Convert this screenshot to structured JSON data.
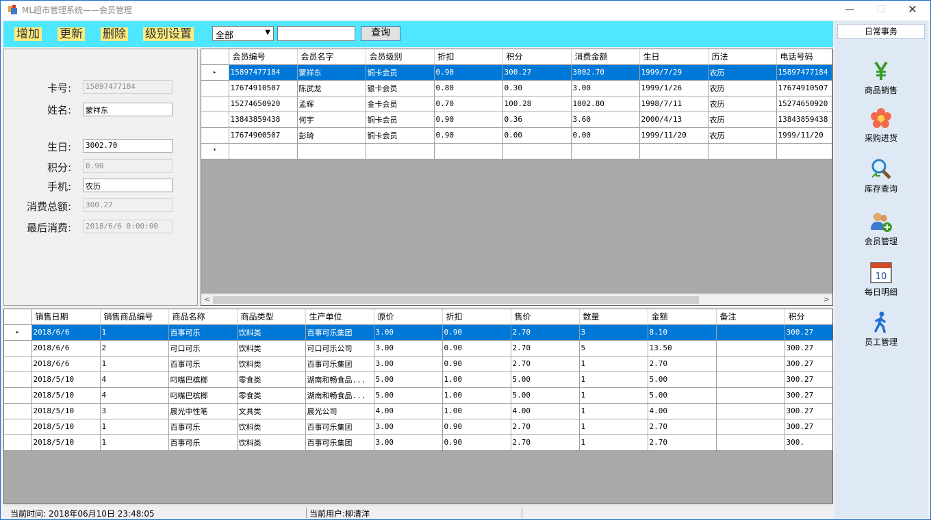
{
  "window": {
    "title": "ML超市管理系统——会员管理"
  },
  "toolbar": {
    "add_label": "增加",
    "update_label": "更新",
    "delete_label": "删除",
    "level_label": "级别设置",
    "filter_value": "全部",
    "search_value": "",
    "query_label": "查询"
  },
  "form": {
    "card_label": "卡号:",
    "card_value": "15897477184",
    "name_label": "姓名:",
    "name_value": "蒙祥东",
    "birthday_label": "生日:",
    "birthday_value": "3002.70",
    "points_label": "积分:",
    "points_value": "0.90",
    "phone_label": "手机:",
    "phone_value": "农历",
    "total_label": "消费总额:",
    "total_value": "300.27",
    "last_label": "最后消费:",
    "last_value": "2018/6/6 0:00:00"
  },
  "members": {
    "columns": [
      "会员编号",
      "会员名字",
      "会员级别",
      "折扣",
      "积分",
      "消费金额",
      "生日",
      "历法",
      "电话号码"
    ],
    "rows": [
      [
        "15897477184",
        "蒙祥东",
        "铜卡会员",
        "0.90",
        "300.27",
        "3002.70",
        "1999/7/29",
        "农历",
        "15897477184"
      ],
      [
        "17674910507",
        "陈武龙",
        "银卡会员",
        "0.80",
        "0.30",
        "3.00",
        "1999/1/26",
        "农历",
        "17674910507"
      ],
      [
        "15274650920",
        "孟辉",
        "金卡会员",
        "0.70",
        "100.28",
        "1002.80",
        "1998/7/11",
        "农历",
        "15274650920"
      ],
      [
        "13843859438",
        "何宇",
        "铜卡会员",
        "0.90",
        "0.36",
        "3.60",
        "2000/4/13",
        "农历",
        "13843859438"
      ],
      [
        "17674900507",
        "彭琦",
        "铜卡会员",
        "0.90",
        "0.00",
        "0.00",
        "1999/11/20",
        "农历",
        "1999/11/20"
      ]
    ],
    "new_row_marker": "*",
    "selected_marker": "▸"
  },
  "sales": {
    "columns": [
      "销售日期",
      "销售商品编号",
      "商品名称",
      "商品类型",
      "生产单位",
      "原价",
      "折扣",
      "售价",
      "数量",
      "金额",
      "备注",
      "积分"
    ],
    "rows": [
      [
        "2018/6/6",
        "1",
        "百事可乐",
        "饮料类",
        "百事可乐集团",
        "3.00",
        "0.90",
        "2.70",
        "3",
        "8.10",
        "",
        "300.27"
      ],
      [
        "2018/6/6",
        "2",
        "可口可乐",
        "饮料类",
        "可口可乐公司",
        "3.00",
        "0.90",
        "2.70",
        "5",
        "13.50",
        "",
        "300.27"
      ],
      [
        "2018/6/6",
        "1",
        "百事可乐",
        "饮料类",
        "百事可乐集团",
        "3.00",
        "0.90",
        "2.70",
        "1",
        "2.70",
        "",
        "300.27"
      ],
      [
        "2018/5/10",
        "4",
        "叼嘴巴槟榔",
        "零食类",
        "湖南和畅食品...",
        "5.00",
        "1.00",
        "5.00",
        "1",
        "5.00",
        "",
        "300.27"
      ],
      [
        "2018/5/10",
        "4",
        "叼嘴巴槟榔",
        "零食类",
        "湖南和畅食品...",
        "5.00",
        "1.00",
        "5.00",
        "1",
        "5.00",
        "",
        "300.27"
      ],
      [
        "2018/5/10",
        "3",
        "晨光中性笔",
        "文具类",
        "晨光公司",
        "4.00",
        "1.00",
        "4.00",
        "1",
        "4.00",
        "",
        "300.27"
      ],
      [
        "2018/5/10",
        "1",
        "百事可乐",
        "饮料类",
        "百事可乐集团",
        "3.00",
        "0.90",
        "2.70",
        "1",
        "2.70",
        "",
        "300.27"
      ],
      [
        "2018/5/10",
        "1",
        "百事可乐",
        "饮料类",
        "百事可乐集团",
        "3.00",
        "0.90",
        "2.70",
        "1",
        "2.70",
        "",
        "300."
      ]
    ],
    "overflow_cell": "300.",
    "selected_marker": "▸"
  },
  "sidenav": {
    "header": "日常事务",
    "items": [
      {
        "label": "商品销售",
        "icon": "yen-icon"
      },
      {
        "label": "采购进货",
        "icon": "flower-icon"
      },
      {
        "label": "库存查询",
        "icon": "magnifier-icon"
      },
      {
        "label": "会员管理",
        "icon": "users-add-icon"
      },
      {
        "label": "每日明细",
        "icon": "calendar-icon",
        "calendar_day": "10"
      },
      {
        "label": "员工管理",
        "icon": "walking-person-icon"
      }
    ]
  },
  "status": {
    "time": "当前时间: 2018年06月10日  23:48:05",
    "user": "当前用户:柳清洋"
  },
  "colors": {
    "toolbar_bg": "#4fe6ff",
    "button_bg": "#ffec80",
    "selection": "#0078d7",
    "sidenav_bg": "#dfe9f5"
  }
}
